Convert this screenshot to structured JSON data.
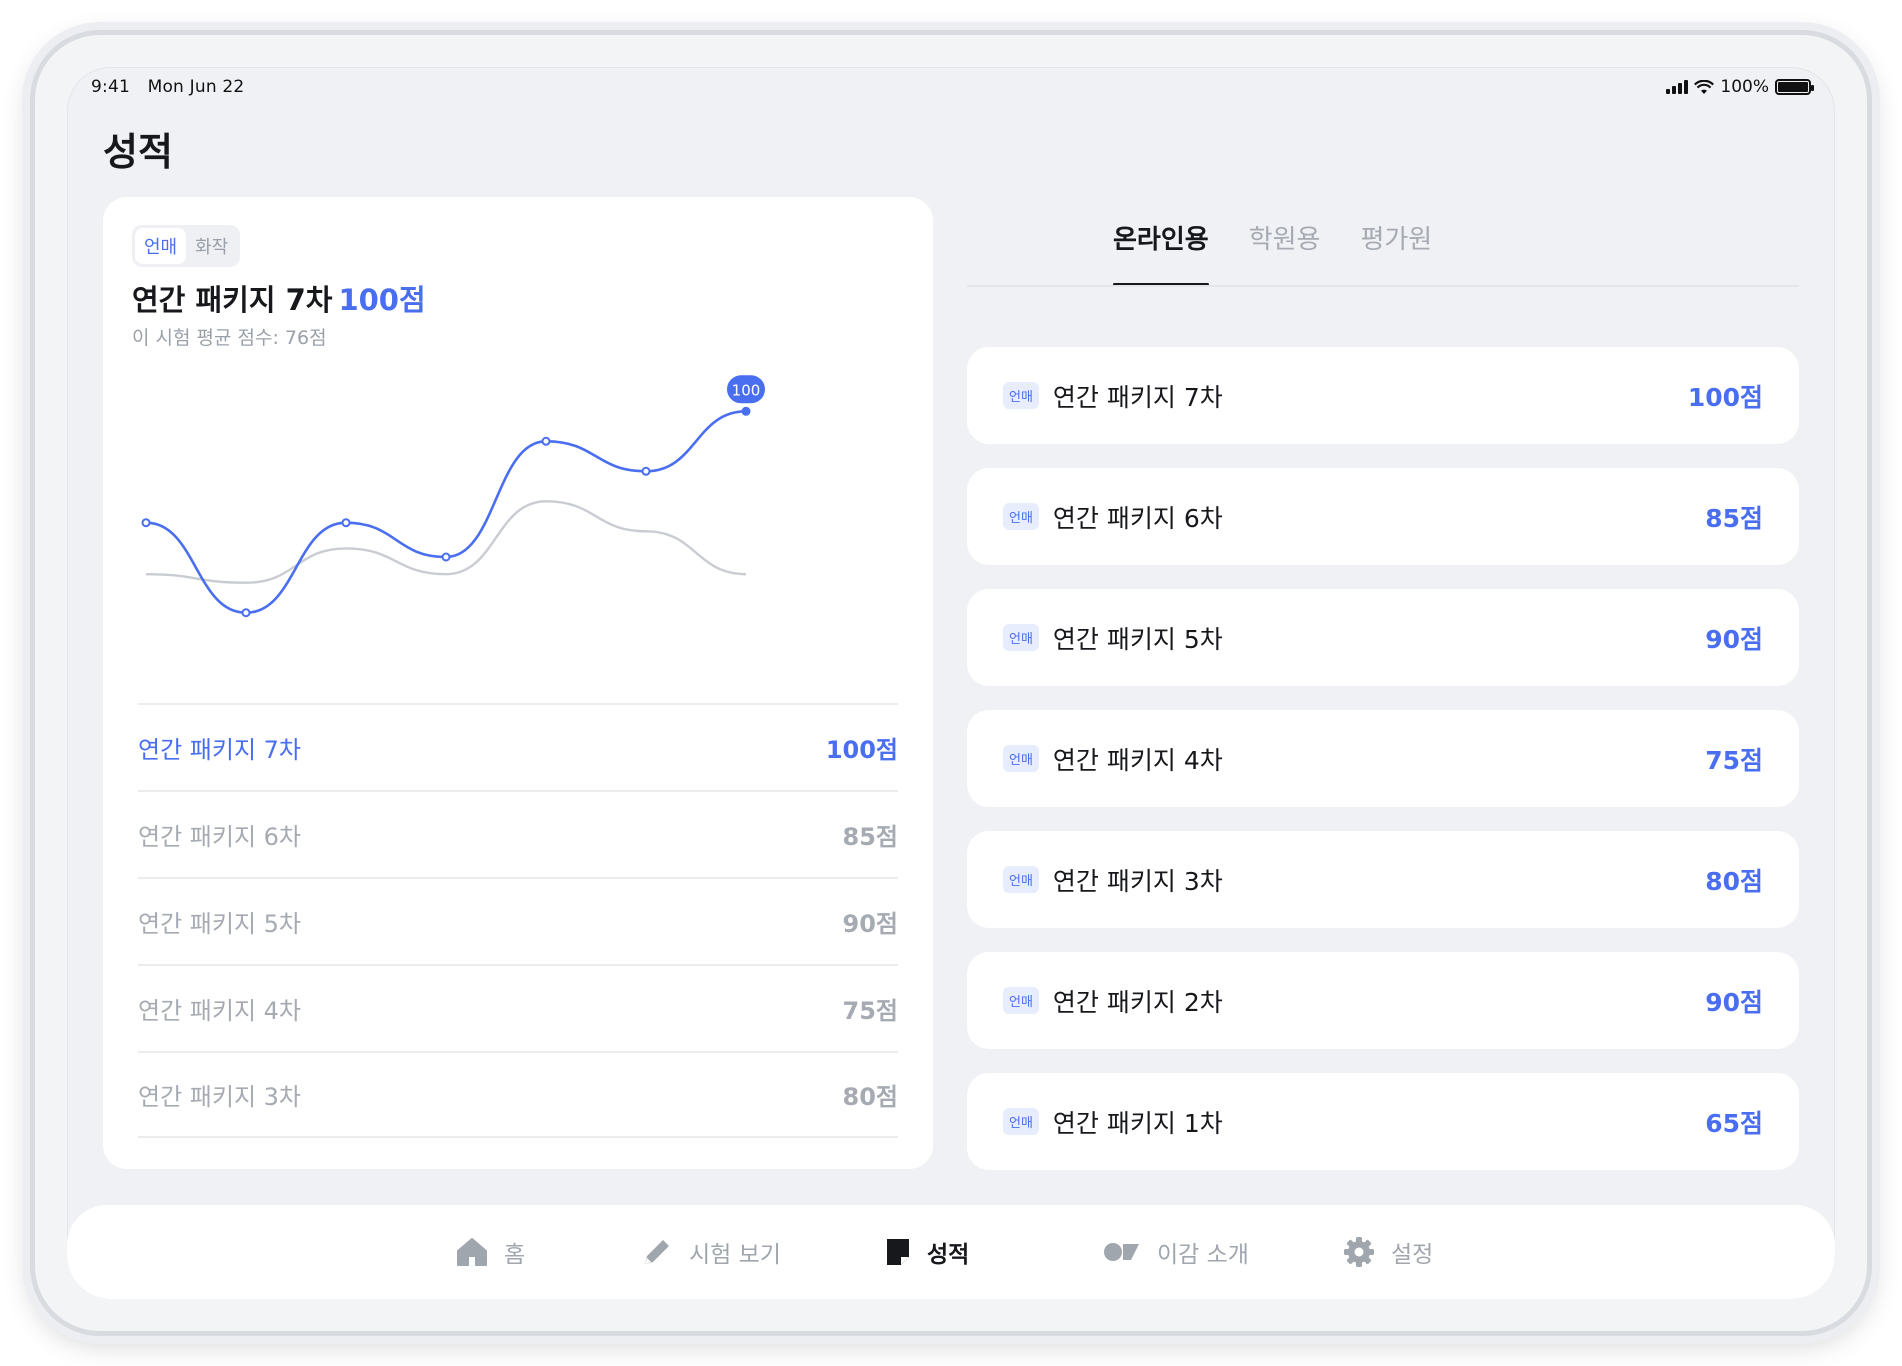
{
  "status_bar": {
    "time": "9:41",
    "date": "Mon Jun 22",
    "battery": "100%"
  },
  "page_title": "성적",
  "left_card": {
    "segments": [
      {
        "label": "언매",
        "active": true
      },
      {
        "label": "화작",
        "active": false
      }
    ],
    "title": "연간 패키지 7차",
    "title_score": "100점",
    "subtitle": "이 시험 평균 점수: 76점",
    "tooltip": "100",
    "scores": [
      {
        "name": "연간 패키지 7차",
        "value": "100점",
        "active": true
      },
      {
        "name": "연간 패키지 6차",
        "value": "85점",
        "active": false
      },
      {
        "name": "연간 패키지 5차",
        "value": "90점",
        "active": false
      },
      {
        "name": "연간 패키지 4차",
        "value": "75점",
        "active": false
      },
      {
        "name": "연간 패키지 3차",
        "value": "80점",
        "active": false
      }
    ]
  },
  "chart_data": {
    "type": "line",
    "series": [
      {
        "values": [
          76,
          55,
          76,
          68,
          95,
          88,
          102
        ],
        "color": "#4a6ef0"
      },
      {
        "values": [
          64,
          62,
          70,
          64,
          81,
          74,
          64
        ],
        "color": "#c9ccd2"
      }
    ],
    "highlight_label": "100",
    "xlabel": "",
    "ylabel": "",
    "ylim": [
      40,
      110
    ],
    "grid": false
  },
  "tabs": [
    {
      "label": "온라인용",
      "active": true
    },
    {
      "label": "학원용",
      "active": false
    },
    {
      "label": "평가원",
      "active": false
    }
  ],
  "exam_list": [
    {
      "badge": "언매",
      "name": "연간 패키지 7차",
      "score": "100점"
    },
    {
      "badge": "언매",
      "name": "연간 패키지 6차",
      "score": "85점"
    },
    {
      "badge": "언매",
      "name": "연간 패키지 5차",
      "score": "90점"
    },
    {
      "badge": "언매",
      "name": "연간 패키지 4차",
      "score": "75점"
    },
    {
      "badge": "언매",
      "name": "연간 패키지 3차",
      "score": "80점"
    },
    {
      "badge": "언매",
      "name": "연간 패키지 2차",
      "score": "90점"
    },
    {
      "badge": "언매",
      "name": "연간 패키지 1차",
      "score": "65점"
    }
  ],
  "tab_bar": [
    {
      "label": "홈",
      "icon": "home-icon",
      "active": false
    },
    {
      "label": "시험 보기",
      "icon": "pencil-icon",
      "active": false
    },
    {
      "label": "성적",
      "icon": "grade-icon",
      "active": true
    },
    {
      "label": "이감 소개",
      "icon": "intro-icon",
      "active": false
    },
    {
      "label": "설정",
      "icon": "gear-icon",
      "active": false
    }
  ],
  "colors": {
    "accent": "#4a6ef0",
    "muted": "#a6abb3",
    "background": "#f0f1f4"
  }
}
